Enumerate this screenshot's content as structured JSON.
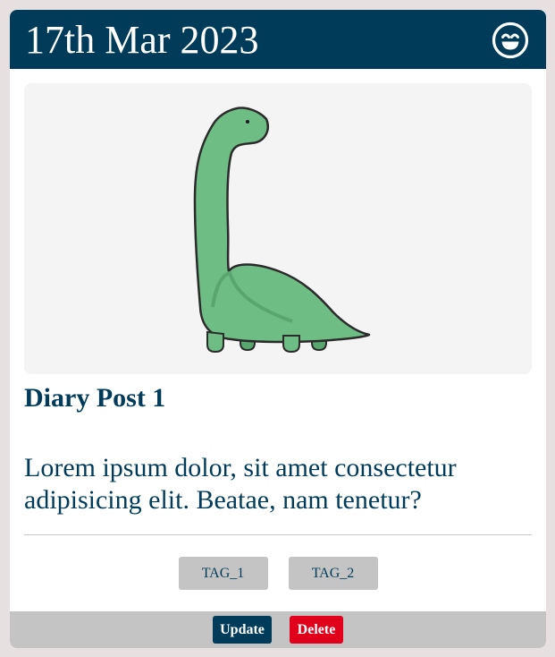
{
  "post": {
    "date": "17th Mar 2023",
    "mood_icon": "smiling-face-icon",
    "image_subject": "dinosaur-illustration",
    "title": "Diary Post 1",
    "body": "Lorem ipsum dolor, sit amet consectetur adipisicing elit. Beatae, nam tenetur?",
    "tags": [
      "TAG_1",
      "TAG_2"
    ]
  },
  "actions": {
    "update_label": "Update",
    "delete_label": "Delete"
  },
  "colors": {
    "header_bg": "#003c5a",
    "update_bg": "#003c5a",
    "delete_bg": "#e0001b",
    "tag_bg": "#c4c4c4",
    "dino_fill": "#6ebd84"
  }
}
